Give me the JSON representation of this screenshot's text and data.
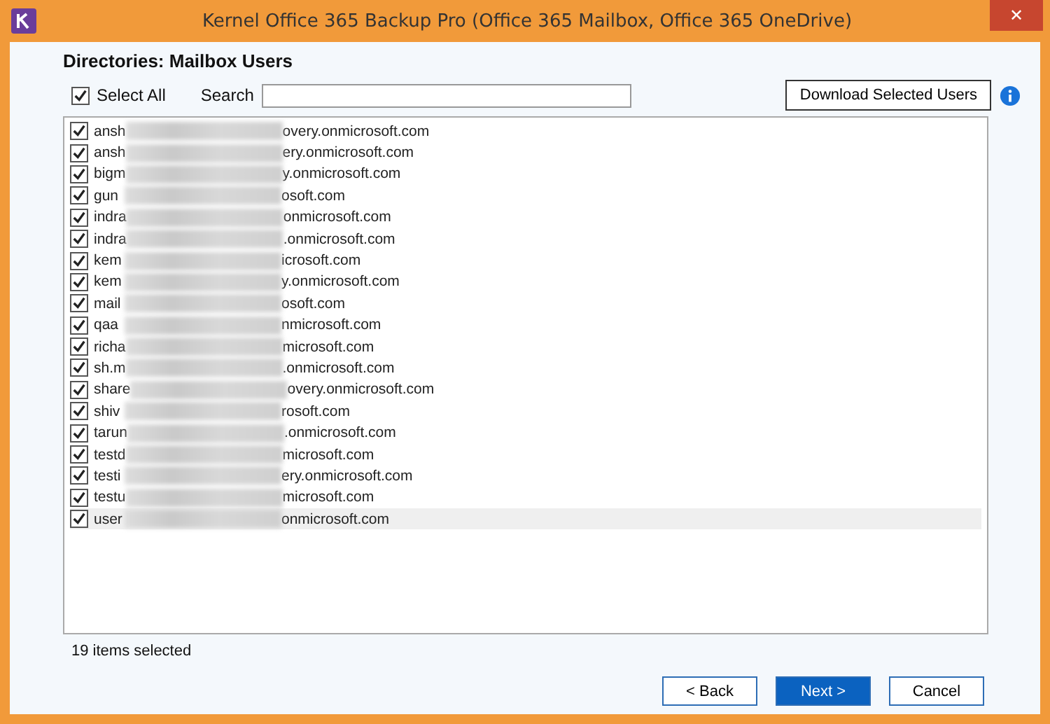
{
  "window": {
    "title": "Kernel Office 365 Backup Pro (Office 365 Mailbox, Office 365 OneDrive)",
    "close": "✕"
  },
  "heading": "Directories: Mailbox Users",
  "select_all": {
    "label": "Select All",
    "checked": true
  },
  "search": {
    "label": "Search"
  },
  "download_button": "Download Selected Users",
  "users": [
    {
      "prefix": "ansh",
      "suffix": "overy.onmicrosoft.com",
      "checked": true,
      "selected": false
    },
    {
      "prefix": "ansh",
      "suffix": "ery.onmicrosoft.com",
      "checked": true,
      "selected": false
    },
    {
      "prefix": "bigm",
      "suffix": "y.onmicrosoft.com",
      "checked": true,
      "selected": false
    },
    {
      "prefix": "gun",
      "suffix": "osoft.com",
      "checked": true,
      "selected": false
    },
    {
      "prefix": "indra",
      "suffix": "onmicrosoft.com",
      "checked": true,
      "selected": false
    },
    {
      "prefix": "indra",
      "suffix": ".onmicrosoft.com",
      "checked": true,
      "selected": false
    },
    {
      "prefix": "kem",
      "suffix": "icrosoft.com",
      "checked": true,
      "selected": false
    },
    {
      "prefix": "kem",
      "suffix": "y.onmicrosoft.com",
      "checked": true,
      "selected": false
    },
    {
      "prefix": "mail",
      "suffix": "osoft.com",
      "checked": true,
      "selected": false
    },
    {
      "prefix": "qaa",
      "suffix": "nmicrosoft.com",
      "checked": true,
      "selected": false
    },
    {
      "prefix": "richa",
      "suffix": "microsoft.com",
      "checked": true,
      "selected": false
    },
    {
      "prefix": "sh.m",
      "suffix": ".onmicrosoft.com",
      "checked": true,
      "selected": false
    },
    {
      "prefix": "share",
      "suffix": "overy.onmicrosoft.com",
      "checked": true,
      "selected": false
    },
    {
      "prefix": "shiv",
      "suffix": "rosoft.com",
      "checked": true,
      "selected": false
    },
    {
      "prefix": "tarun",
      "suffix": ".onmicrosoft.com",
      "checked": true,
      "selected": false
    },
    {
      "prefix": "testd",
      "suffix": "microsoft.com",
      "checked": true,
      "selected": false
    },
    {
      "prefix": "testi",
      "suffix": "ery.onmicrosoft.com",
      "checked": true,
      "selected": false
    },
    {
      "prefix": "testu",
      "suffix": "microsoft.com",
      "checked": true,
      "selected": false
    },
    {
      "prefix": "user",
      "suffix": "onmicrosoft.com",
      "checked": true,
      "selected": true
    }
  ],
  "status": "19 items selected",
  "buttons": [
    {
      "label": "< Back",
      "kind": "normal"
    },
    {
      "label": "Next >",
      "kind": "primary"
    },
    {
      "label": "Cancel",
      "kind": "normal"
    }
  ]
}
